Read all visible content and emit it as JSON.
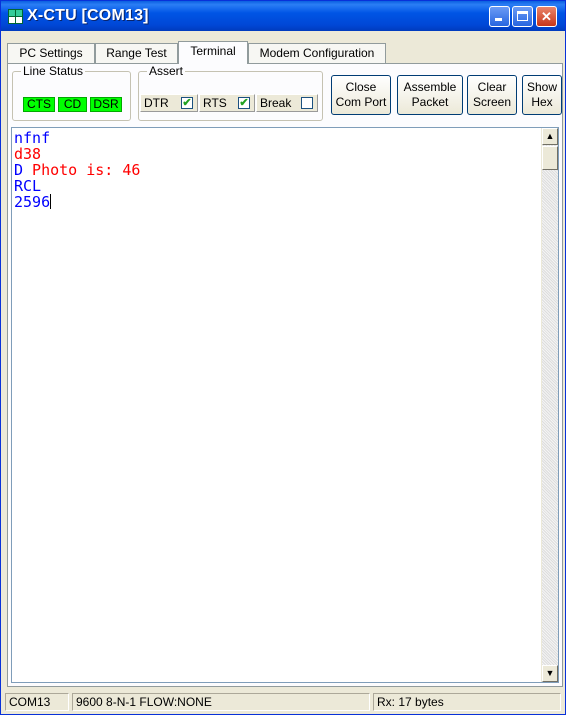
{
  "window": {
    "title": "X-CTU  [COM13]",
    "controls": {
      "minimize_icon": "minimize-icon",
      "maximize_icon": "maximize-icon",
      "close_icon": "close-icon"
    }
  },
  "tabs": [
    {
      "label": "PC Settings",
      "active": false
    },
    {
      "label": "Range Test",
      "active": false
    },
    {
      "label": "Terminal",
      "active": true
    },
    {
      "label": "Modem Configuration",
      "active": false
    }
  ],
  "line_status": {
    "label": "Line Status",
    "leds": [
      "CTS",
      "CD",
      "DSR"
    ],
    "led_color": "#00ff00"
  },
  "assert": {
    "label": "Assert",
    "items": [
      {
        "label": "DTR",
        "checked": true
      },
      {
        "label": "RTS",
        "checked": true
      },
      {
        "label": "Break",
        "checked": false
      }
    ]
  },
  "buttons": {
    "close_com": "Close\nCom Port",
    "assemble": "Assemble\nPacket",
    "clear": "Clear\nScreen",
    "show_hex": "Show\nHex"
  },
  "terminal": {
    "lines": [
      {
        "text": "nfnf",
        "color": "#0000ff"
      },
      {
        "text": "d38",
        "color": "#ff0000"
      },
      {
        "text": "D Photo is: 46",
        "color": "#ff0000",
        "prefix": "D",
        "prefix_color": "#0000ff",
        "rest": " Photo is: 46"
      },
      {
        "text": "RCL",
        "color": "#0000ff"
      },
      {
        "text": "2596",
        "color": "#0000ff"
      }
    ]
  },
  "statusbar": {
    "port": "COM13",
    "settings": "9600 8-N-1  FLOW:NONE",
    "rx": "Rx: 17 bytes"
  }
}
